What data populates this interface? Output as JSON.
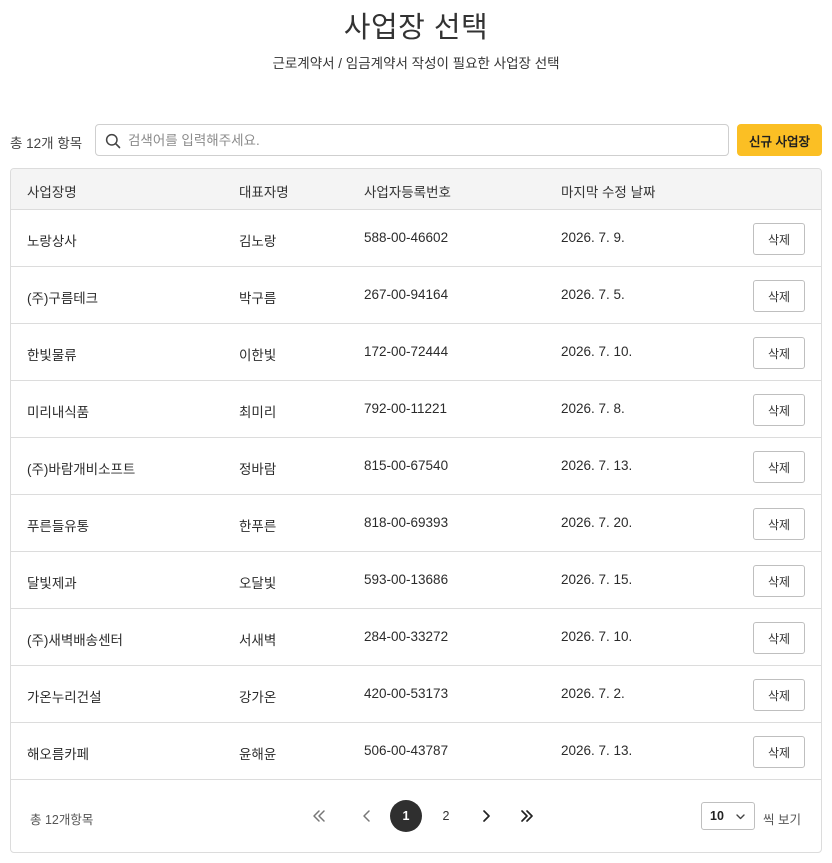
{
  "header": {
    "title": "사업장 선택",
    "subtitle": "근로계약서 / 임금계약서 작성이 필요한 사업장 선택"
  },
  "toolbar": {
    "total_label": "총 12개 항목",
    "search_placeholder": "검색어를 입력해주세요.",
    "search_value": "",
    "new_button_label": "신규 사업장"
  },
  "table": {
    "columns": [
      "사업장명",
      "대표자명",
      "사업자등록번호",
      "마지막 수정 날짜"
    ],
    "delete_label": "삭제",
    "rows": [
      {
        "name": "노랑상사",
        "rep": "김노랑",
        "reg": "588-00-46602",
        "date": "2026. 7. 9."
      },
      {
        "name": "(주)구름테크",
        "rep": "박구름",
        "reg": "267-00-94164",
        "date": "2026. 7. 5."
      },
      {
        "name": "한빛물류",
        "rep": "이한빛",
        "reg": "172-00-72444",
        "date": "2026. 7. 10."
      },
      {
        "name": "미리내식품",
        "rep": "최미리",
        "reg": "792-00-11221",
        "date": "2026. 7. 8."
      },
      {
        "name": "(주)바람개비소프트",
        "rep": "정바람",
        "reg": "815-00-67540",
        "date": "2026. 7. 13."
      },
      {
        "name": "푸른들유통",
        "rep": "한푸른",
        "reg": "818-00-69393",
        "date": "2026. 7. 20."
      },
      {
        "name": "달빛제과",
        "rep": "오달빛",
        "reg": "593-00-13686",
        "date": "2026. 7. 15."
      },
      {
        "name": "(주)새벽배송센터",
        "rep": "서새벽",
        "reg": "284-00-33272",
        "date": "2026. 7. 10."
      },
      {
        "name": "가온누리건설",
        "rep": "강가온",
        "reg": "420-00-53173",
        "date": "2026. 7. 2."
      },
      {
        "name": "해오름카페",
        "rep": "윤해윤",
        "reg": "506-00-43787",
        "date": "2026. 7. 13."
      }
    ]
  },
  "footer": {
    "total_label": "총 12개항목",
    "pages": [
      "1",
      "2"
    ],
    "current_page": "1",
    "page_size": "10",
    "page_size_suffix": "씩 보기"
  },
  "icons": {
    "search": "search-icon",
    "first": "chevrons-left-icon",
    "prev": "chevron-left-icon",
    "next": "chevron-right-icon",
    "last": "chevrons-right-icon",
    "dropdown": "chevron-down-icon"
  },
  "colors": {
    "accent": "#fbbf24",
    "active_page": "#2f2f2f",
    "header_bg": "#f4f4f4",
    "border": "#dcdcdc"
  }
}
